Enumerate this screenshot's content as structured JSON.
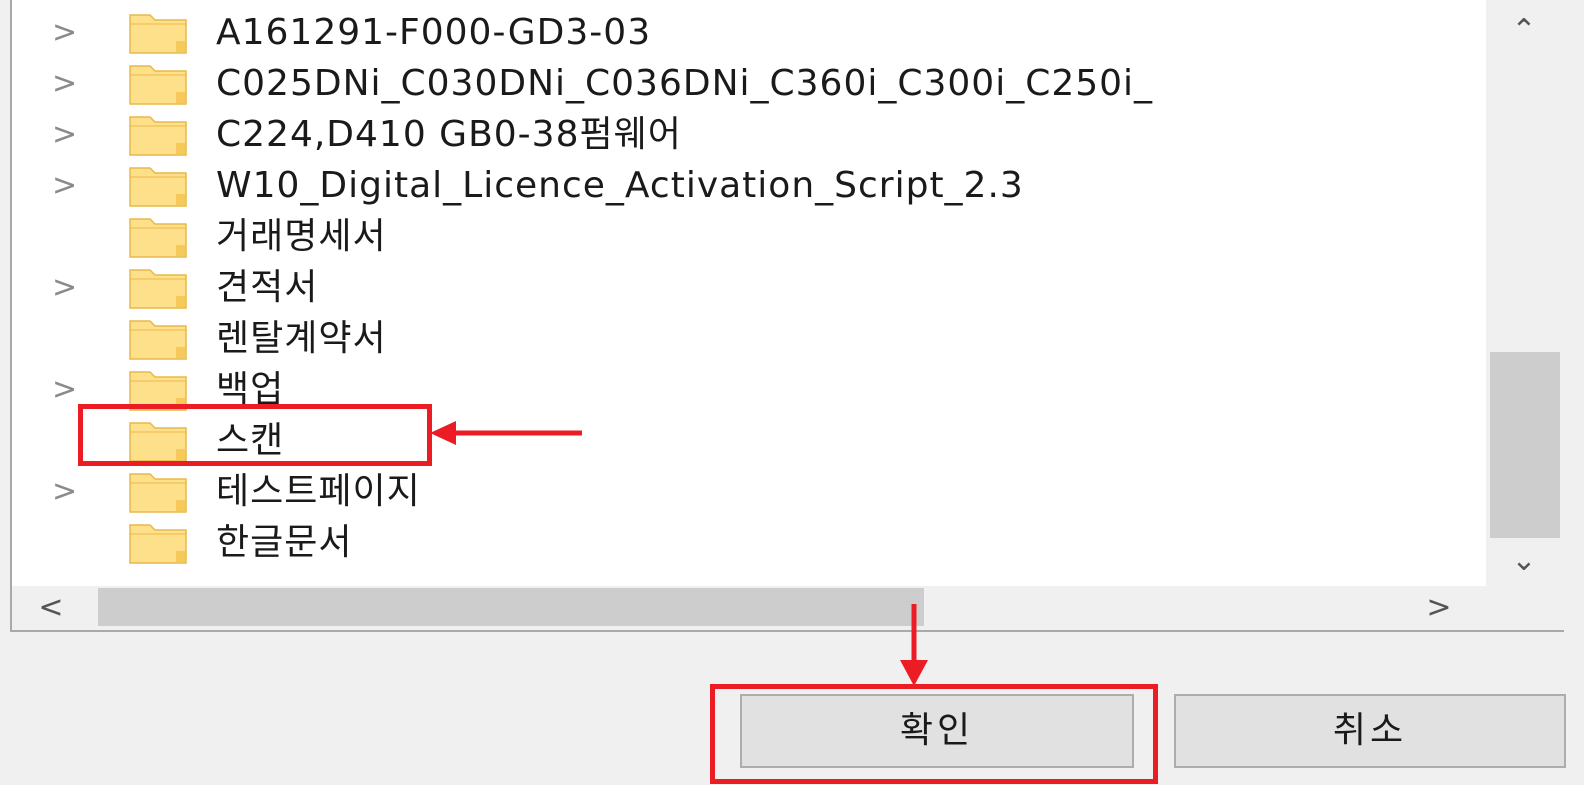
{
  "folders": [
    {
      "name": "A161291-F000-GD3-03",
      "expandable": true
    },
    {
      "name": "C025DNi_C030DNi_C036DNi_C360i_C300i_C250i_",
      "expandable": true
    },
    {
      "name": "C224,D410 GB0-38펌웨어",
      "expandable": true
    },
    {
      "name": "W10_Digital_Licence_Activation_Script_2.3",
      "expandable": true
    },
    {
      "name": "거래명세서",
      "expandable": false
    },
    {
      "name": "견적서",
      "expandable": true
    },
    {
      "name": "렌탈계약서",
      "expandable": false
    },
    {
      "name": "백업",
      "expandable": true
    },
    {
      "name": "스캔",
      "expandable": false
    },
    {
      "name": "테스트페이지",
      "expandable": true
    },
    {
      "name": "한글문서",
      "expandable": false
    }
  ],
  "icons": {
    "expander": "chevron-right-icon",
    "folder": "folder-icon",
    "scroll_up": "chevron-up-icon",
    "scroll_down": "chevron-down-icon",
    "scroll_left": "chevron-left-icon",
    "scroll_right": "chevron-right-icon"
  },
  "buttons": {
    "ok_label": "확인",
    "cancel_label": "취소"
  },
  "colors": {
    "annotation": "#ec1c24",
    "folder_fill": "#ffe08a",
    "folder_edge": "#e8b84a"
  }
}
